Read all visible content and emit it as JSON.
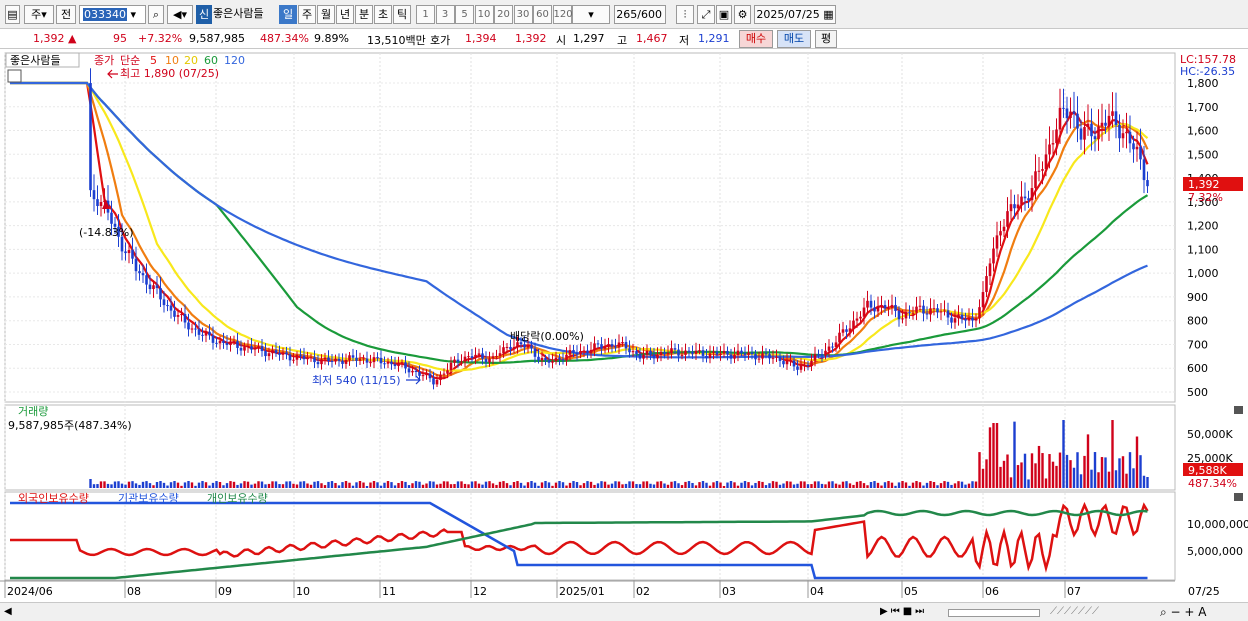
{
  "toolbar": {
    "market": "주",
    "mode": "전",
    "stock_code": "033340",
    "credit_badge": "신",
    "stock_name": "좋은사람들",
    "periods": [
      "일",
      "주",
      "월",
      "년",
      "분",
      "초",
      "틱"
    ],
    "active_period": "일",
    "numbers": [
      "1",
      "3",
      "5",
      "10",
      "20",
      "30",
      "60",
      "120"
    ],
    "count": "265",
    "count_total": "/600",
    "date": "2025/07/25"
  },
  "quote": {
    "price": "1,392",
    "change_sign": "▲",
    "change": "95",
    "change_pct": "+7.32%",
    "volume": "9,587,985",
    "volume_pct": "487.34%",
    "turnover": "9.89%",
    "amount": "13,510백만",
    "hoga_label": "호가",
    "ask": "1,394",
    "bid": "1,392",
    "open_label": "시",
    "open": "1,297",
    "high_label": "고",
    "high": "1,467",
    "low_label": "저",
    "low": "1,291",
    "buy_label": "매수",
    "sell_label": "매도",
    "eval_label": "평"
  },
  "colors": {
    "up": "#d0021b",
    "down": "#1c3fd0",
    "ma5": "#e01010",
    "ma10": "#f07d10",
    "ma20": "#f8e81c",
    "ma60": "#1a9a3a",
    "ma120": "#3366dd",
    "foreign": "#dd1111",
    "inst": "#2255dd",
    "indiv": "#22884a"
  },
  "chart_data": [
    {
      "type": "candlestick",
      "legend": {
        "name": "좋은사람들",
        "price_label": "종가",
        "ma_label": "단순",
        "ma_periods": [
          "5",
          "10",
          "20",
          "60",
          "120"
        ]
      },
      "lc_label": "LC:157.78",
      "hc_label": "HC:-26.35",
      "ylim": [
        450,
        1850
      ],
      "y_ticks": [
        1800,
        1700,
        1600,
        1500,
        1400,
        1300,
        1200,
        1100,
        1000,
        900,
        800,
        700,
        600,
        500
      ],
      "y_tick_labels": [
        "1,800",
        "1,700",
        "1,600",
        "1,500",
        "1,400",
        "1,300",
        "1,200",
        "1,100",
        "1,000",
        "900",
        "800",
        "700",
        "600",
        "500"
      ],
      "annotations": {
        "high": "최고 1,890 (07/25)",
        "low": "최저 540 (11/15)",
        "gap": "(-14.83%)",
        "dividend": "배당락(0.00%)"
      },
      "last_price_label": "1,392",
      "last_pct_label": "7.32%",
      "approx_daily_path": [
        [
          0,
          1800
        ],
        [
          22,
          1800
        ],
        [
          23,
          1330
        ],
        [
          25,
          1320
        ],
        [
          28,
          1250
        ],
        [
          32,
          1120
        ],
        [
          36,
          1020
        ],
        [
          40,
          950
        ],
        [
          45,
          860
        ],
        [
          50,
          790
        ],
        [
          55,
          740
        ],
        [
          60,
          710
        ],
        [
          70,
          680
        ],
        [
          80,
          650
        ],
        [
          90,
          630
        ],
        [
          100,
          640
        ],
        [
          110,
          620
        ],
        [
          118,
          570
        ],
        [
          121,
          545
        ],
        [
          124,
          580
        ],
        [
          128,
          640
        ],
        [
          133,
          650
        ],
        [
          138,
          640
        ],
        [
          143,
          700
        ],
        [
          148,
          690
        ],
        [
          153,
          620
        ],
        [
          158,
          650
        ],
        [
          163,
          670
        ],
        [
          168,
          690
        ],
        [
          172,
          700
        ],
        [
          176,
          690
        ],
        [
          180,
          650
        ],
        [
          190,
          670
        ],
        [
          200,
          660
        ],
        [
          210,
          660
        ],
        [
          220,
          640
        ],
        [
          225,
          600
        ],
        [
          230,
          640
        ],
        [
          235,
          700
        ],
        [
          240,
          780
        ],
        [
          245,
          860
        ],
        [
          250,
          860
        ],
        [
          255,
          820
        ],
        [
          260,
          850
        ],
        [
          265,
          840
        ],
        [
          270,
          810
        ],
        [
          275,
          800
        ],
        [
          278,
          900
        ],
        [
          280,
          1050
        ],
        [
          283,
          1200
        ],
        [
          288,
          1300
        ],
        [
          292,
          1350
        ],
        [
          296,
          1500
        ],
        [
          300,
          1650
        ],
        [
          303,
          1700
        ],
        [
          306,
          1580
        ],
        [
          310,
          1600
        ],
        [
          314,
          1650
        ],
        [
          318,
          1600
        ],
        [
          322,
          1500
        ],
        [
          325,
          1392
        ]
      ]
    },
    {
      "type": "bar",
      "title": "거래량",
      "current_label": "9,587,985주(487.34%)",
      "y_tick_labels": [
        "50,000K",
        "25,000K"
      ],
      "last_label": "9,588K",
      "last_pct_label": "487.34%"
    },
    {
      "type": "line",
      "series": [
        {
          "name": "외국인보유수량"
        },
        {
          "name": "기관보유수량"
        },
        {
          "name": "개인보유수량"
        }
      ],
      "y_ticks": [
        10000000,
        5000000
      ],
      "y_tick_labels": [
        "10,000,000",
        "5,000,000"
      ]
    }
  ],
  "x_axis": {
    "labels": [
      "2024/06",
      "08",
      "09",
      "10",
      "11",
      "12",
      "2025/01",
      "02",
      "03",
      "04",
      "05",
      "06",
      "07"
    ],
    "right_label": "07/25"
  }
}
